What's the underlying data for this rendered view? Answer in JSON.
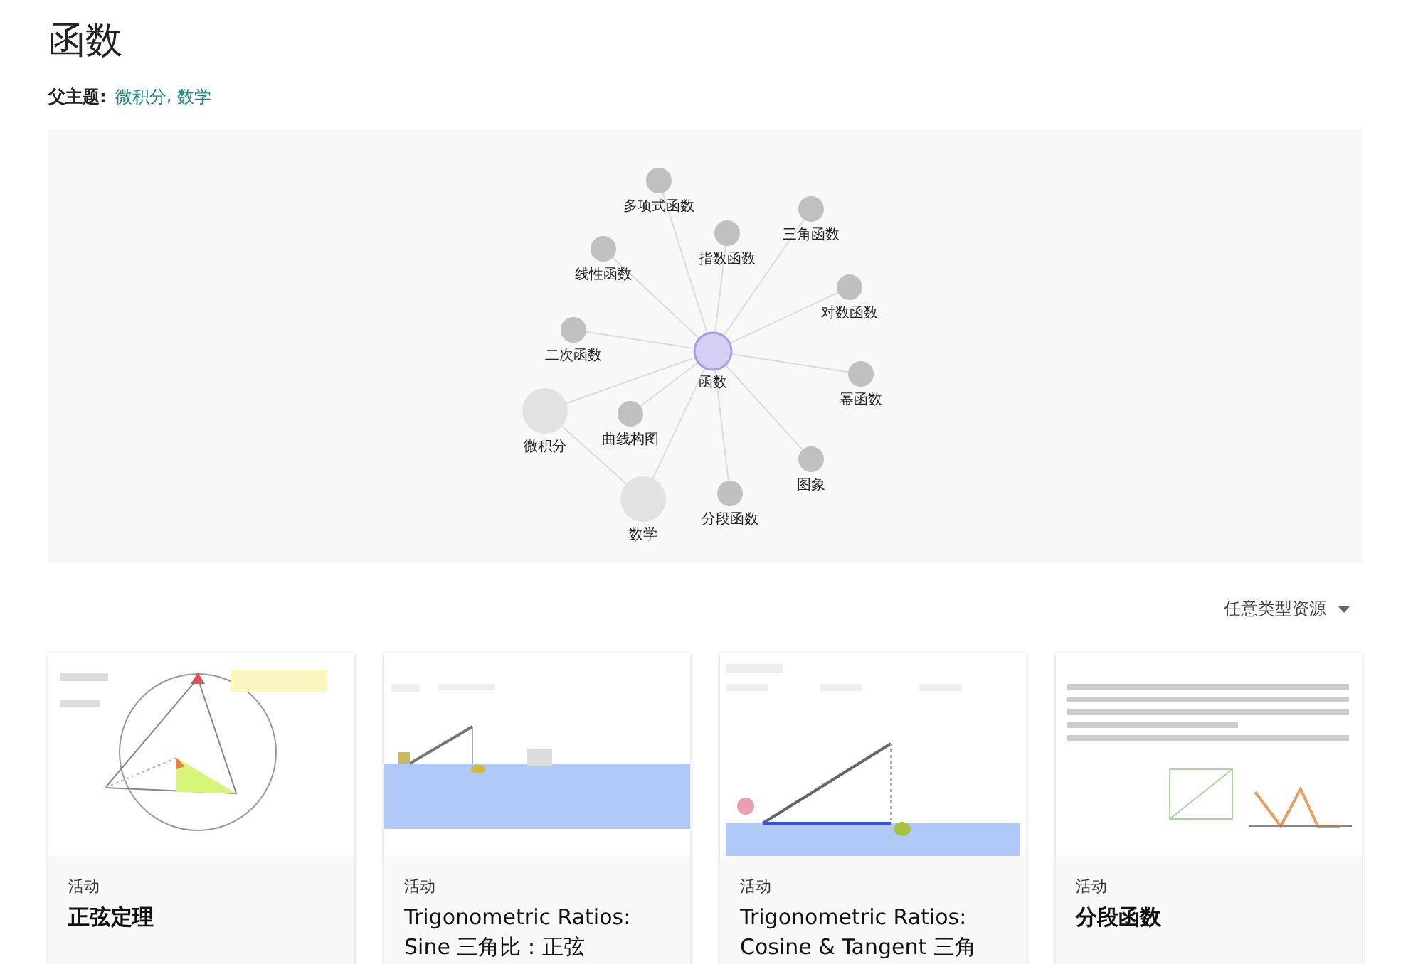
{
  "title": "函数",
  "parent_topics": {
    "label": "父主题:",
    "separator": ",",
    "links": [
      "微积分",
      "数学"
    ]
  },
  "graph": {
    "nodes": [
      {
        "label": "函数",
        "kind": "center"
      },
      {
        "label": "多项式函数",
        "kind": "child"
      },
      {
        "label": "指数函数",
        "kind": "child"
      },
      {
        "label": "三角函数",
        "kind": "child"
      },
      {
        "label": "线性函数",
        "kind": "child"
      },
      {
        "label": "对数函数",
        "kind": "child"
      },
      {
        "label": "二次函数",
        "kind": "child"
      },
      {
        "label": "幂函数",
        "kind": "child"
      },
      {
        "label": "曲线构图",
        "kind": "child"
      },
      {
        "label": "微积分",
        "kind": "parent"
      },
      {
        "label": "图象",
        "kind": "child"
      },
      {
        "label": "分段函数",
        "kind": "child"
      },
      {
        "label": "数学",
        "kind": "parent"
      }
    ]
  },
  "filter": {
    "label": "任意类型资源"
  },
  "cards": [
    {
      "kind": "picture",
      "type": "活动",
      "title": "正弦定理"
    },
    {
      "kind": "picture",
      "type": "活动",
      "title": "Trigonometric Ratios: Sine 三角比：正弦"
    },
    {
      "kind": "picture",
      "type": "活动",
      "title": "Trigonometric Ratios: Cosine & Tangent 三角"
    },
    {
      "kind": "picture",
      "type": "活动",
      "title": "分段函数"
    }
  ]
}
